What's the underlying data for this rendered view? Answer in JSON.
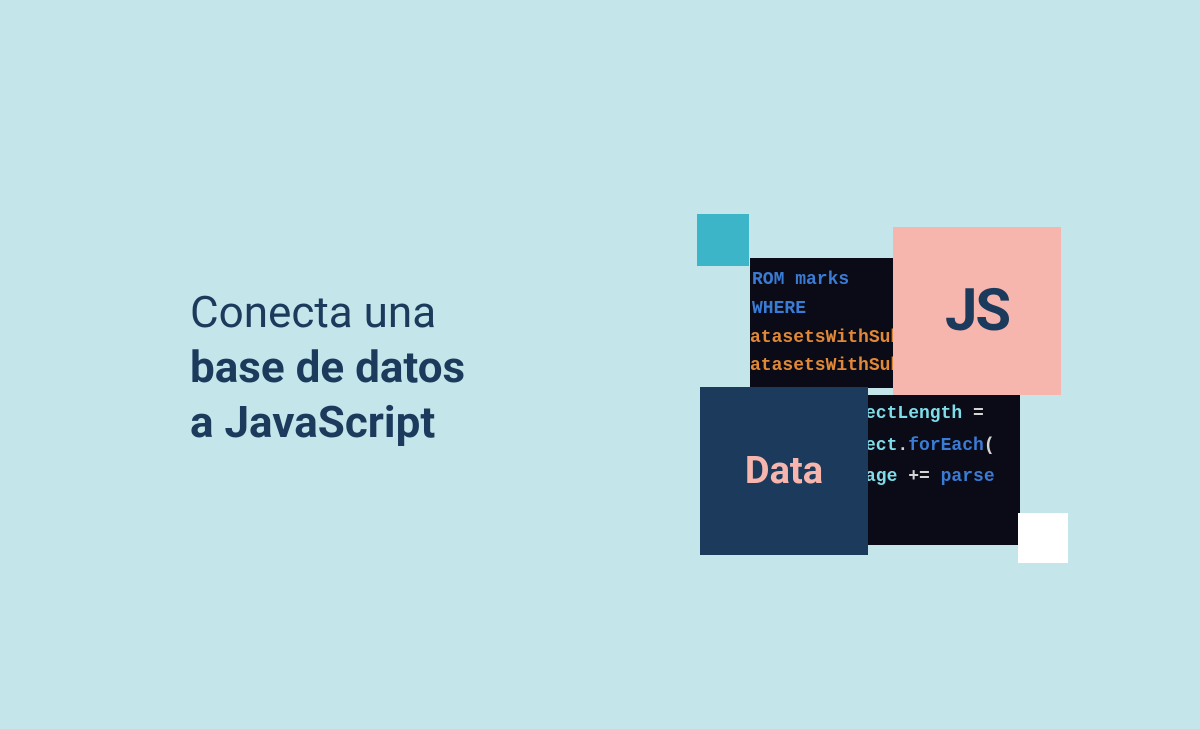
{
  "headline": {
    "line1": "Conecta una",
    "line2": "base de datos",
    "line3": "a JavaScript"
  },
  "cards": {
    "js": "JS",
    "data": "Data"
  },
  "code1": {
    "line1": "ROM marks WHERE",
    "line2": "atasetsWithSubj",
    "line3": "atasetsWithSubje"
  },
  "code2": {
    "line1a": "ectLength",
    "line1b": " =",
    "line2a": "ect",
    "line2b": ".",
    "line2c": "forEach",
    "line2d": "(",
    "line3a": "age ",
    "line3b": "+= ",
    "line3c": "parse"
  },
  "colors": {
    "background": "#c4e5ea",
    "navy": "#1c3a5c",
    "pink": "#f7b6ad",
    "teal": "#3cb5c8",
    "white": "#ffffff",
    "codeBg": "#0a0b16"
  }
}
